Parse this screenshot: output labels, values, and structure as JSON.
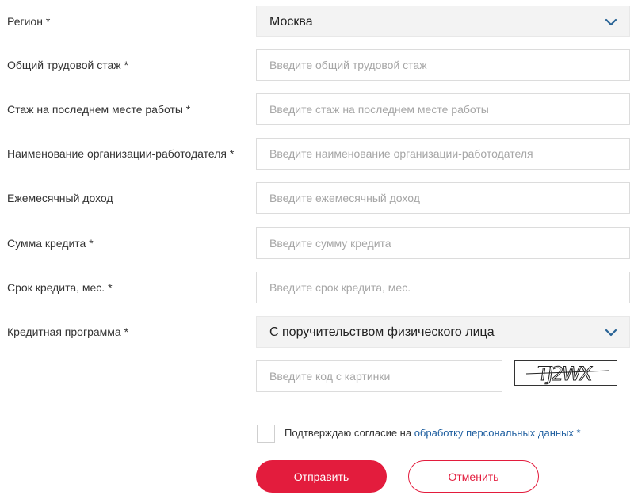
{
  "form": {
    "region": {
      "label": "Регион *",
      "value": "Москва"
    },
    "total_experience": {
      "label": "Общий трудовой стаж *",
      "placeholder": "Введите общий трудовой стаж"
    },
    "last_job_experience": {
      "label": "Стаж на последнем месте работы *",
      "placeholder": "Введите стаж на последнем месте работы"
    },
    "employer_name": {
      "label": "Наименование организации-работодателя *",
      "placeholder": "Введите наименование организации-работодателя"
    },
    "monthly_income": {
      "label": "Ежемесячный доход",
      "placeholder": "Введите ежемесячный доход"
    },
    "loan_amount": {
      "label": "Сумма кредита *",
      "placeholder": "Введите сумму кредита"
    },
    "loan_term": {
      "label": "Срок кредита, мес. *",
      "placeholder": "Введите срок кредита, мес."
    },
    "credit_program": {
      "label": "Кредитная программа *",
      "value": "С поручительством физического лица"
    },
    "captcha": {
      "placeholder": "Введите код с картинки",
      "image_text": "TJ2WX"
    },
    "consent": {
      "text": "Подтверждаю согласие на ",
      "link": "обработку персональных данных",
      "required_mark": " *",
      "checked": false
    },
    "submit_label": "Отправить",
    "cancel_label": "Отменить"
  },
  "colors": {
    "accent": "#e31c3d",
    "link": "#1f5fa0",
    "chevron": "#2a6496",
    "select_bg": "#f3f3f3",
    "border": "#dcdcdc"
  },
  "icons": {
    "dropdown": "chevron-down-icon"
  }
}
